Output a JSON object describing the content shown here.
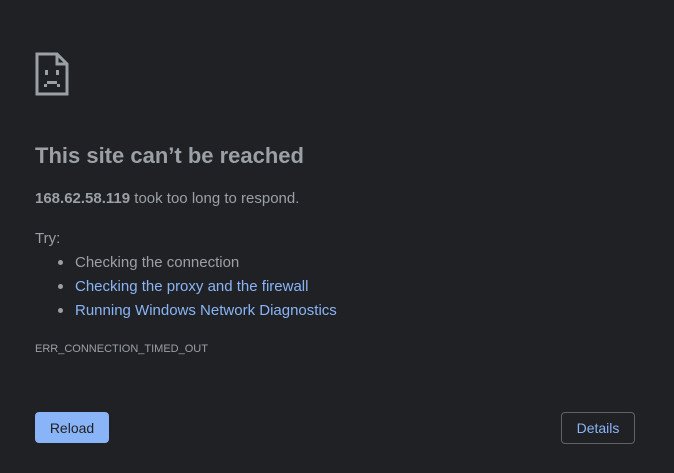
{
  "page": {
    "icon": "sad-page-icon",
    "title": "This site can’t be reached",
    "host": "168.62.58.119",
    "message": " took too long to respond.",
    "try_label": "Try:",
    "suggestions": [
      {
        "label": "Checking the connection",
        "is_link": false
      },
      {
        "label": "Checking the proxy and the firewall",
        "is_link": true
      },
      {
        "label": "Running Windows Network Diagnostics",
        "is_link": true
      }
    ],
    "error_code": "ERR_CONNECTION_TIMED_OUT"
  },
  "buttons": {
    "reload_label": "Reload",
    "details_label": "Details"
  },
  "colors": {
    "background": "#202124",
    "text": "#9aa0a6",
    "link": "#8ab4f8",
    "primary_button": "#8ab4f8",
    "outline": "#5f6368"
  }
}
